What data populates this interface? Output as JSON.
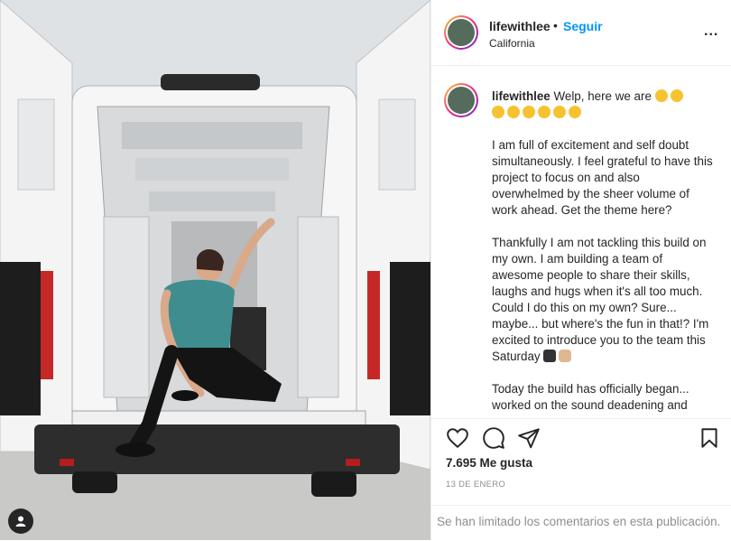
{
  "post": {
    "username": "lifewithlee",
    "follow_label": "Seguir",
    "separator": "•",
    "location": "California",
    "more_label": "...",
    "caption_intro": "Welp, here we are",
    "paragraphs": [
      "I am full of excitement and self doubt simultaneously. I feel grateful to have this project to focus on and also overwhelmed by the sheer volume of work ahead. Get the theme here?",
      "Thankfully I am not tackling this build on my own. I am building a team of awesome people to share their skills, laughs and hugs when it's all too much. Could I do this on my own? Sure... maybe... but where's the fun in that!? I'm excited to introduce you to the team this Saturday",
      "Today the build has officially began... worked on the sound deadening and"
    ],
    "likes": "7.695 Me gusta",
    "date": "13 DE ENERO",
    "comments_disabled": "Se han limitado los comentarios en esta publicación."
  },
  "icons": {
    "heart": "heart-icon",
    "comment": "comment-icon",
    "share": "share-icon",
    "save": "bookmark-icon",
    "user_tag": "user-tag-icon"
  },
  "colors": {
    "accent": "#0095f6",
    "text": "#262626",
    "muted": "#8e8e8e",
    "border": "#efefef",
    "emoji": "#f6c230"
  }
}
